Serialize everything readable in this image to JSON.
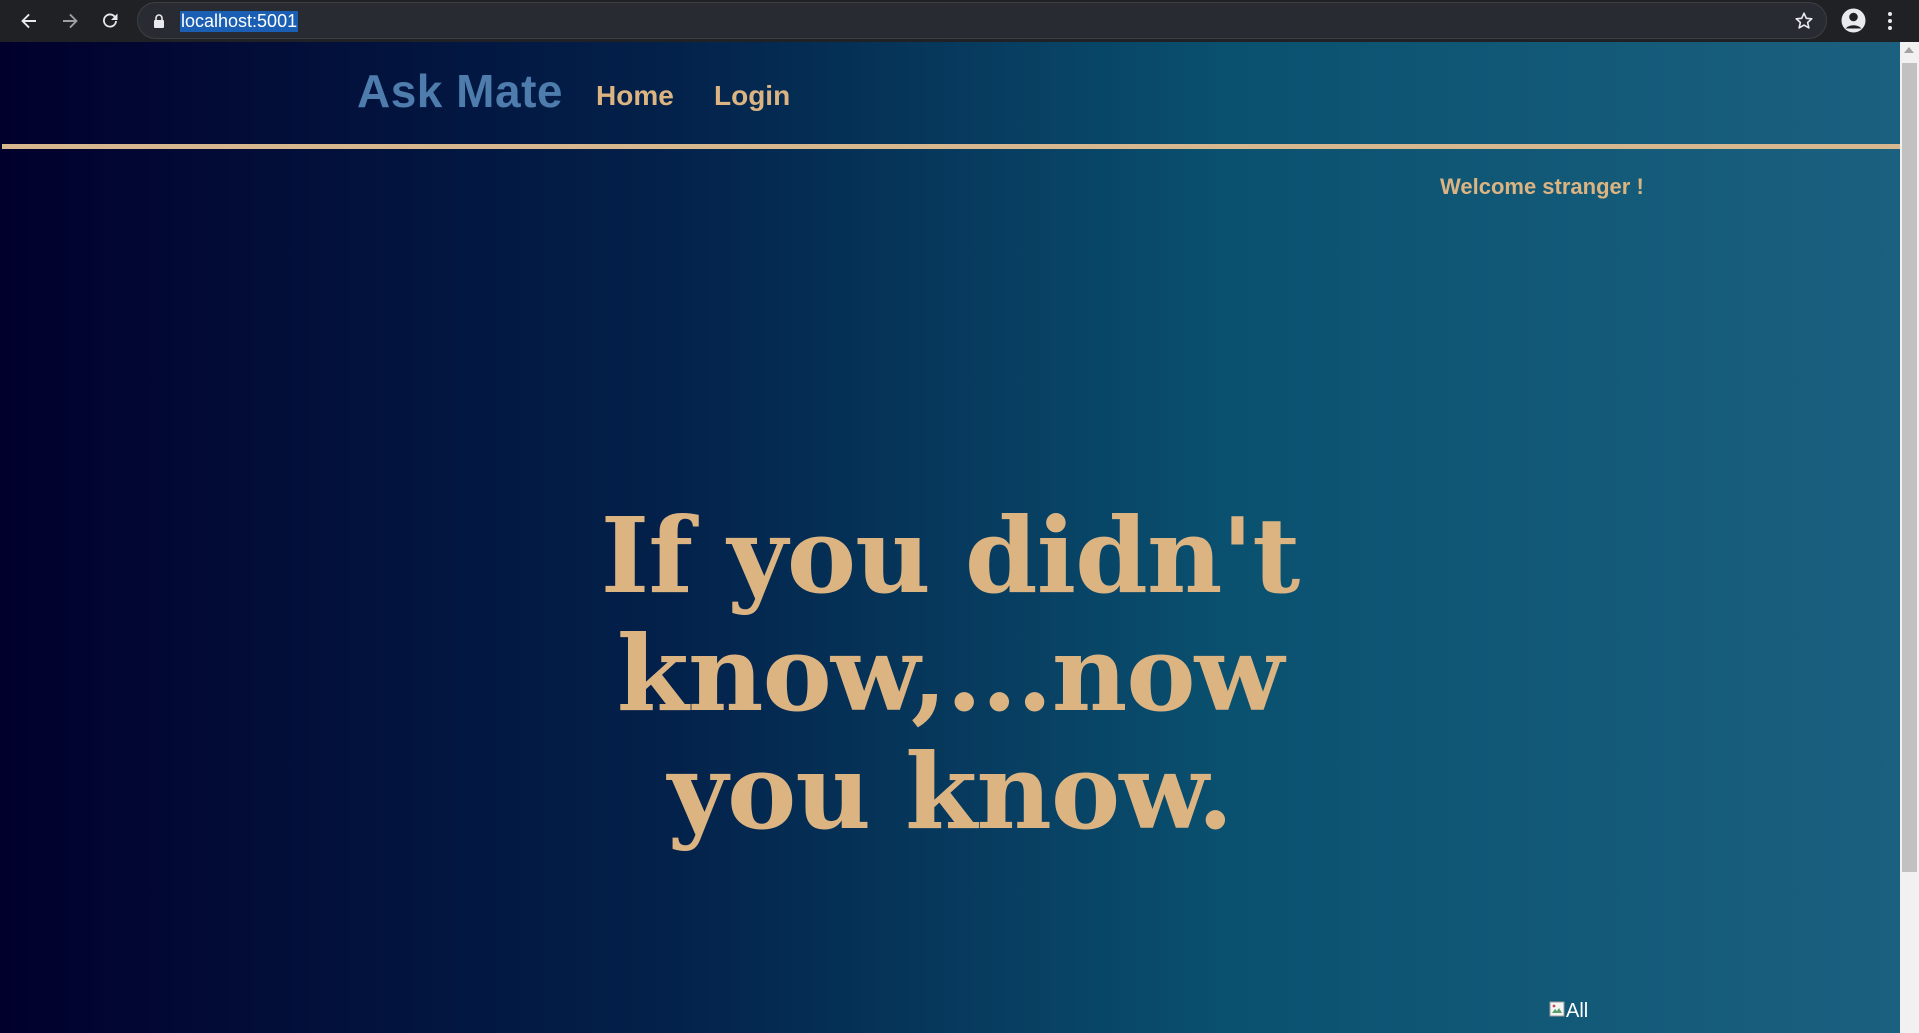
{
  "browser": {
    "url": "localhost:5001",
    "back_icon": "back-arrow-icon",
    "forward_icon": "forward-arrow-icon",
    "reload_icon": "reload-icon",
    "lock_icon": "lock-icon",
    "bookmark_icon": "star-icon",
    "profile_icon": "account-circle-icon",
    "menu_icon": "kebab-menu-icon"
  },
  "site": {
    "brand": "Ask Mate",
    "nav": {
      "home": "Home",
      "login": "Login"
    },
    "welcome": "Welcome stranger !",
    "hero_line1": "If you didn't know,...now",
    "hero_line2": "you know.",
    "image_alt": "All"
  },
  "colors": {
    "brand": "#4e7cad",
    "accent": "#dcb482",
    "background_left": "#01002c",
    "background_right": "#1b607f",
    "rule": "#d7b78d"
  }
}
